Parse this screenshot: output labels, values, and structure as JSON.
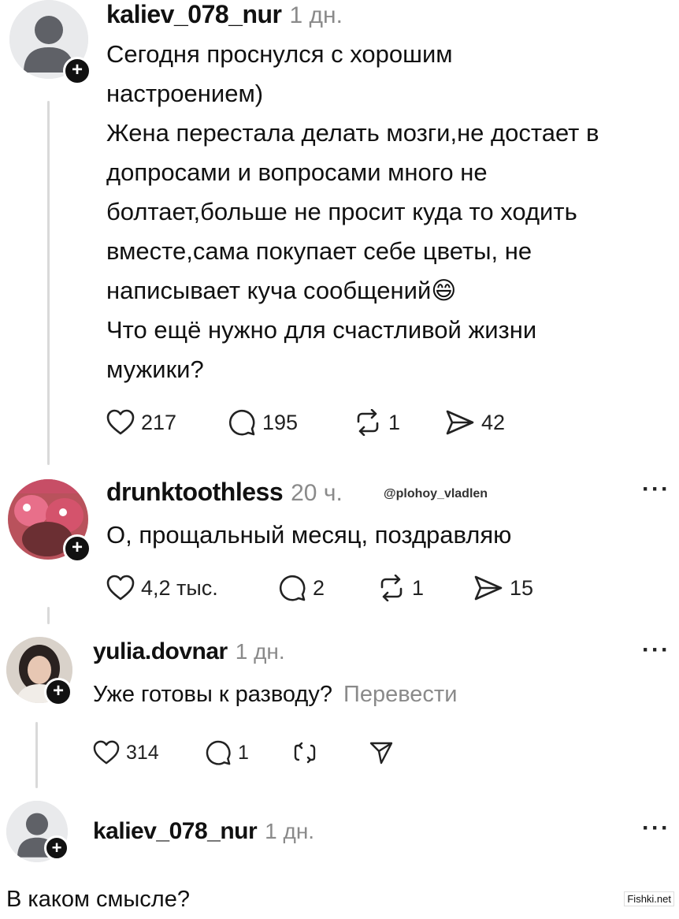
{
  "posts": [
    {
      "username": "kaliev_078_nur",
      "time": "1 дн.",
      "text_lines": [
        "Сегодня проснулся с хорошим",
        "настроением)",
        "Жена перестала делать мозги,не достает в",
        "допросами и вопросами много не",
        "болтает,больше не просит куда то ходить",
        "вместе,сама покупает себе цветы, не",
        "написывает куча сообщений😄",
        "Что ещё нужно для счастливой жизни",
        "мужики?"
      ],
      "likes": "217",
      "comments": "195",
      "reposts": "1",
      "shares": "42"
    },
    {
      "username": "drunktoothless",
      "time": "20 ч.",
      "mention": "@plohoy_vladlen",
      "text": "О, прощальный месяц, поздравляю",
      "likes": "4,2 тыс.",
      "comments": "2",
      "reposts": "1",
      "shares": "15"
    },
    {
      "username": "yulia.dovnar",
      "time": "1 дн.",
      "text": "Уже готовы к разводу?",
      "translate": "Перевести",
      "likes": "314",
      "comments": "1"
    },
    {
      "username": "kaliev_078_nur",
      "time": "1 дн.",
      "text": "В каком смысле?"
    }
  ],
  "more_icon": "···",
  "plus_icon": "+",
  "watermark": "Fishki.net",
  "icons": [
    "heart-icon",
    "comment-icon",
    "repost-icon",
    "share-icon",
    "more-icon",
    "plus-icon",
    "send-icon"
  ]
}
